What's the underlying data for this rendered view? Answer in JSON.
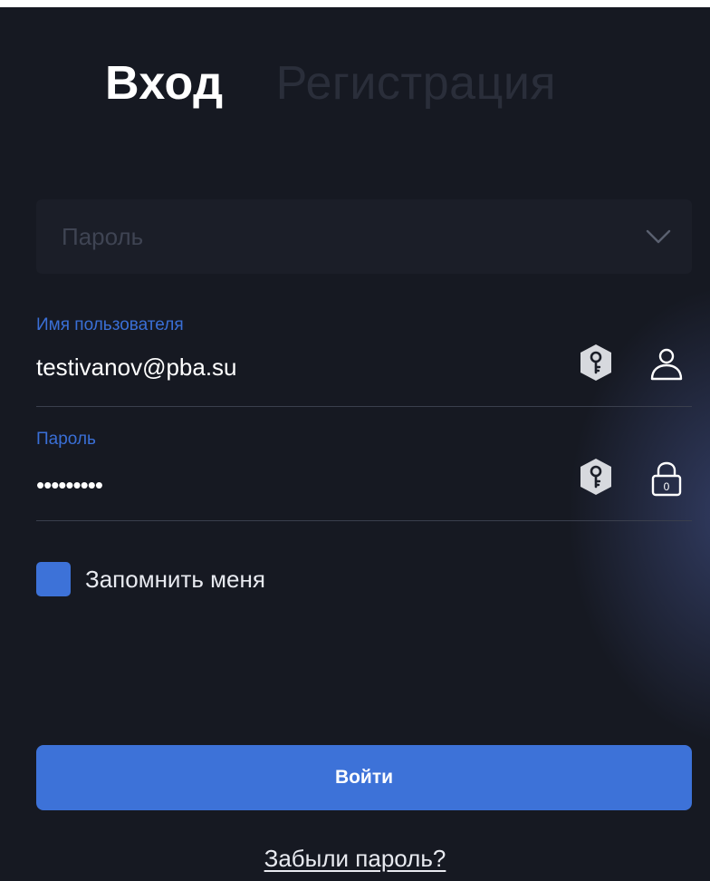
{
  "tabs": {
    "login": "Вход",
    "register": "Регистрация"
  },
  "auth_select": {
    "placeholder": "Пароль",
    "icon": "chevron-down-icon"
  },
  "username_field": {
    "label": "Имя пользователя",
    "value": "testivanov@pba.su",
    "icons": [
      "key-icon",
      "user-icon"
    ]
  },
  "password_field": {
    "label": "Пароль",
    "masked_value": "•••••••••",
    "icons": [
      "key-icon",
      "lock-icon"
    ]
  },
  "remember": {
    "label": "Запомнить меня",
    "checked": true
  },
  "submit_label": "Войти",
  "forgot_link": "Забыли пароль?",
  "colors": {
    "background": "#161922",
    "accent": "#3d72d8",
    "label": "#3a6fd6",
    "text": "#ffffff",
    "muted": "#3f4453"
  }
}
